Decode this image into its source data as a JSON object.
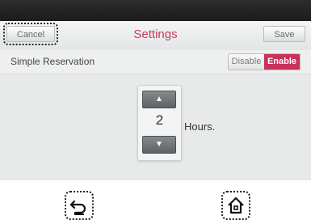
{
  "header": {
    "cancel_label": "Cancel",
    "title": "Settings",
    "save_label": "Save"
  },
  "reservation": {
    "label": "Simple Reservation",
    "options": [
      "Disable",
      "Enable"
    ],
    "selected": "Enable"
  },
  "stepper": {
    "up_icon": "▲",
    "value": "2",
    "down_icon": "▼",
    "unit": "Hours."
  },
  "footer": {
    "back_icon": "back-arrow-icon",
    "home_icon": "home-icon"
  },
  "colors": {
    "accent": "#c8325a",
    "title": "#c63b5c",
    "topbar": "#1b1b1b"
  }
}
